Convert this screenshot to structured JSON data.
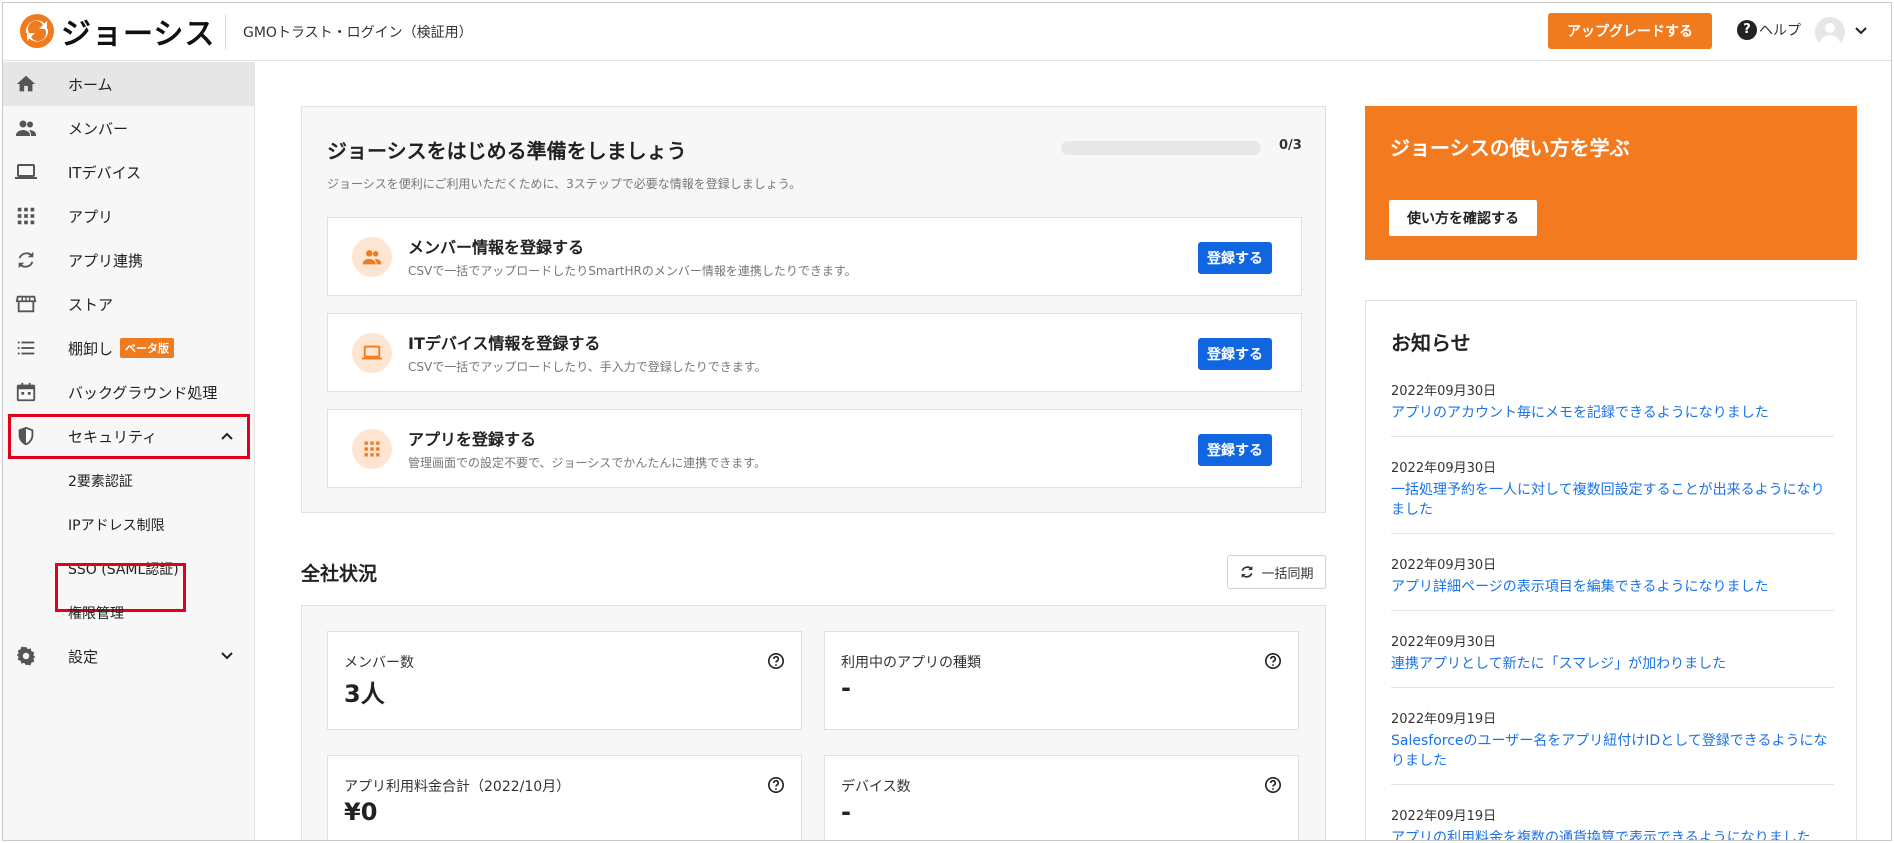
{
  "brand": {
    "logo_text": "ジョーシス",
    "accent": "#f07a1e"
  },
  "header": {
    "org_name": "GMOトラスト・ログイン（検証用）",
    "upgrade_label": "アップグレードする",
    "help_label": "ヘルプ"
  },
  "sidebar": {
    "items": [
      {
        "label": "ホーム",
        "icon": "home-icon"
      },
      {
        "label": "メンバー",
        "icon": "people-icon"
      },
      {
        "label": "ITデバイス",
        "icon": "laptop-icon"
      },
      {
        "label": "アプリ",
        "icon": "apps-grid-icon"
      },
      {
        "label": "アプリ連携",
        "icon": "sync-icon"
      },
      {
        "label": "ストア",
        "icon": "store-icon"
      },
      {
        "label": "棚卸し",
        "icon": "list-icon",
        "badge": "ベータ版"
      },
      {
        "label": "バックグラウンド処理",
        "icon": "calendar-icon"
      },
      {
        "label": "セキュリティ",
        "icon": "shield-icon"
      }
    ],
    "security_sub": [
      "2要素認証",
      "IPアドレス制限",
      "SSO (SAML認証)",
      "権限管理"
    ],
    "settings_label": "設定"
  },
  "setup": {
    "title": "ジョーシスをはじめる準備をしましょう",
    "progress_text": "0/3",
    "progress_fraction": 0,
    "description": "ジョーシスを便利にご利用いただくために、3ステップで必要な情報を登録しましょう。",
    "steps": [
      {
        "title": "メンバー情報を登録する",
        "desc": "CSVで一括でアップロードしたりSmartHRのメンバー情報を連携したりできます。",
        "button": "登録する"
      },
      {
        "title": "ITデバイス情報を登録する",
        "desc": "CSVで一括でアップロードしたり、手入力で登録したりできます。",
        "button": "登録する"
      },
      {
        "title": "アプリを登録する",
        "desc": "管理画面での設定不要で、ジョーシスでかんたんに連携できます。",
        "button": "登録する"
      }
    ]
  },
  "status": {
    "title": "全社状況",
    "sync_label": "一括同期",
    "cards": [
      {
        "label": "メンバー数",
        "value": "3人"
      },
      {
        "label": "利用中のアプリの種類",
        "value": "-"
      },
      {
        "label": "アプリ利用料金合計（2022/10月）",
        "value": "¥0"
      },
      {
        "label": "デバイス数",
        "value": "-"
      }
    ]
  },
  "learn": {
    "title": "ジョーシスの使い方を学ぶ",
    "button": "使い方を確認する"
  },
  "news": {
    "title": "お知らせ",
    "items": [
      {
        "date": "2022年09月30日",
        "text": "アプリのアカウント毎にメモを記録できるようになりました"
      },
      {
        "date": "2022年09月30日",
        "text": "一括処理予約を一人に対して複数回設定することが出来るようになりました"
      },
      {
        "date": "2022年09月30日",
        "text": "アプリ詳細ページの表示項目を編集できるようになりました"
      },
      {
        "date": "2022年09月30日",
        "text": "連携アプリとして新たに「スマレジ」が加わりました"
      },
      {
        "date": "2022年09月19日",
        "text": "Salesforceのユーザー名をアプリ紐付けIDとして登録できるようになりました"
      },
      {
        "date": "2022年09月19日",
        "text": "アプリの利用料金を複数の通貨換算で表示できるようになりました"
      }
    ]
  }
}
